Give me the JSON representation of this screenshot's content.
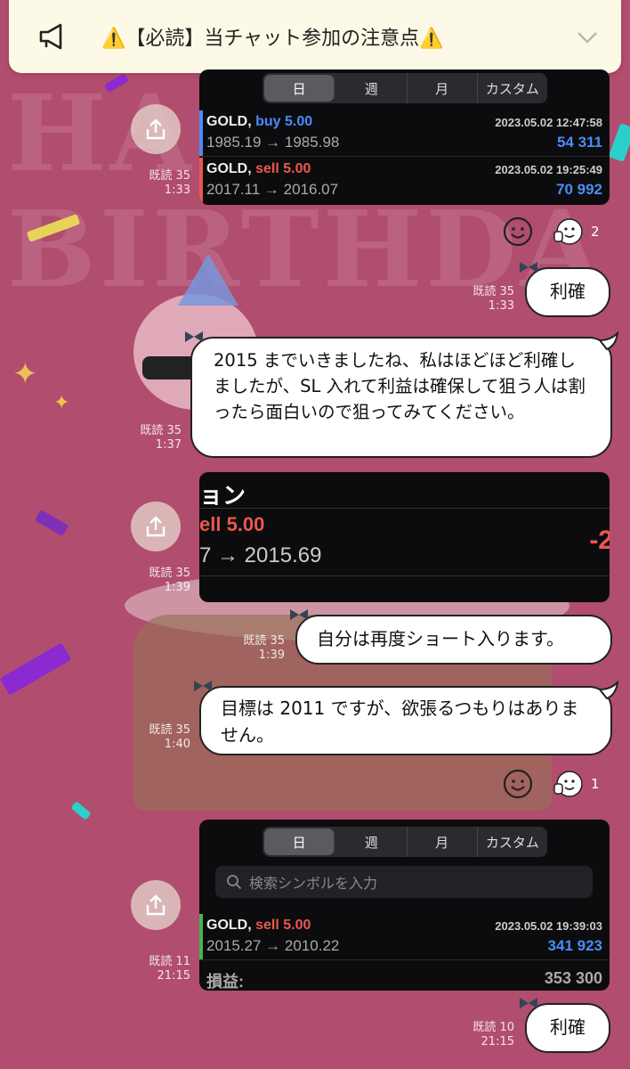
{
  "announcement": {
    "title": "⚠️【必読】当チャット参加の注意点⚠️"
  },
  "background": {
    "line1": "HA",
    "line2": "BIRTHDA"
  },
  "messages": [
    {
      "type": "screenshot",
      "read": "既読 35",
      "time": "1:33",
      "tabs": [
        "日",
        "週",
        "月",
        "カスタム"
      ],
      "trades": [
        {
          "symbol": "GOLD,",
          "side": "buy 5.00",
          "side_kind": "buy",
          "prices": "1985.19 → 1985.98",
          "datetime": "2023.05.02 12:47:58",
          "pnl": "54 311"
        },
        {
          "symbol": "GOLD,",
          "side": "sell 5.00",
          "side_kind": "sell",
          "prices": "2017.11 → 2016.07",
          "datetime": "2023.05.02 19:25:49",
          "pnl": "70 992"
        }
      ]
    },
    {
      "type": "reactions",
      "count": "2"
    },
    {
      "type": "text",
      "read": "既読 35",
      "time": "1:33",
      "text": "利確"
    },
    {
      "type": "text",
      "read": "既読 35",
      "time": "1:37",
      "text": "2015 までいきましたね、私はほどほど利確しましたが、SL 入れて利益は確保して狙う人は割ったら面白いので狙ってみてください。"
    },
    {
      "type": "screenshot2",
      "read": "既読 35",
      "time": "1:39",
      "header": "ョン",
      "side": "ell 5.00",
      "prices": "7 → 2015.69",
      "pnl": "-2"
    },
    {
      "type": "text",
      "read": "既読 35",
      "time": "1:39",
      "text": "自分は再度ショート入ります。"
    },
    {
      "type": "text",
      "read": "既読 35",
      "time": "1:40",
      "text": "目標は 2011 ですが、欲張るつもりはありません。"
    },
    {
      "type": "reactions",
      "count": "1"
    },
    {
      "type": "screenshot3",
      "read": "既読 11",
      "time": "21:15",
      "tabs": [
        "日",
        "週",
        "月",
        "カスタム"
      ],
      "search_placeholder": "検索シンボルを入力",
      "trade": {
        "symbol": "GOLD,",
        "side": "sell 5.00",
        "prices": "2015.27 → 2010.22",
        "datetime": "2023.05.02 19:39:03",
        "pnl": "341 923"
      },
      "summary_label": "損益:",
      "summary_value": "353 300"
    },
    {
      "type": "text",
      "read": "既読 10",
      "time": "21:15",
      "text": "利確"
    }
  ],
  "colors": {
    "background": "#b14d6e",
    "buy": "#4a8cf7",
    "sell": "#e9584d",
    "bubble": "#ffffff"
  }
}
